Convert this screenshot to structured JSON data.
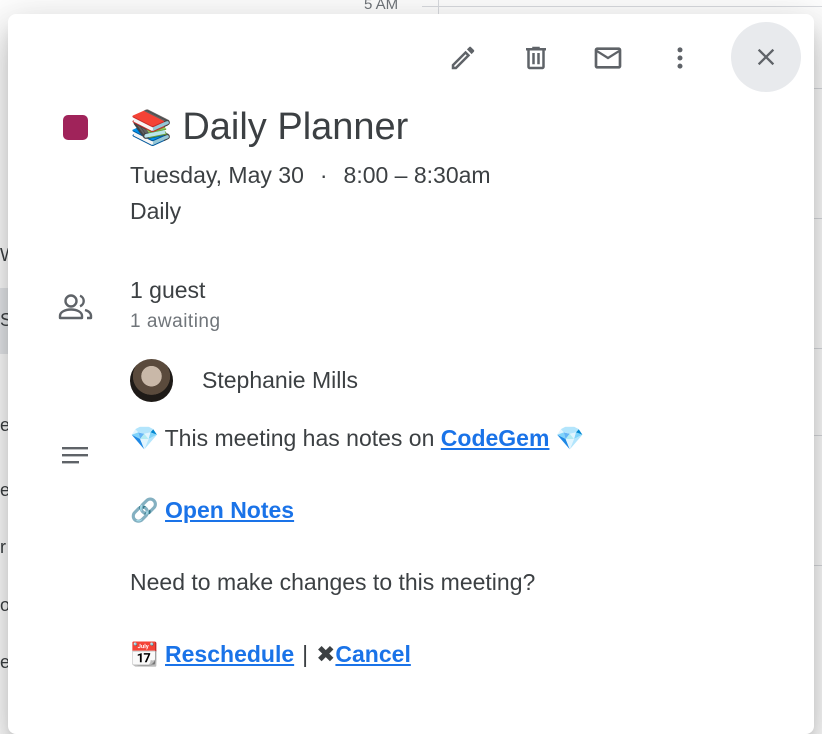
{
  "background": {
    "time_label": "5 AM",
    "fragments": [
      "W",
      "S",
      "e",
      "e",
      "r",
      "o",
      "e"
    ]
  },
  "toolbar": {
    "edit_icon": "pencil-icon",
    "delete_icon": "trash-icon",
    "email_icon": "envelope-icon",
    "more_icon": "more-vert-icon",
    "close_icon": "close-icon"
  },
  "event": {
    "color": "#a0235a",
    "title_emoji": "📚",
    "title": "Daily Planner",
    "date": "Tuesday, May 30",
    "separator": "·",
    "time": "8:00 – 8:30am",
    "recurrence": "Daily"
  },
  "guests": {
    "count": "1 guest",
    "status": "1 awaiting",
    "list": [
      {
        "name": "Stephanie Mills"
      }
    ]
  },
  "description": {
    "line1_prefix_emoji": "💎",
    "line1_text": "This meeting has notes on ",
    "line1_link": "CodeGem",
    "line1_suffix_emoji": "💎",
    "line2_emoji": "🔗",
    "line2_link": "Open Notes",
    "line3_text": "Need to make changes to this meeting?",
    "line4_emoji": "📆",
    "reschedule_link": "Reschedule",
    "divider": "|",
    "cancel_emoji": "✖",
    "cancel_link": "Cancel"
  },
  "colors": {
    "link": "#1a73e8",
    "text": "#3c4043",
    "muted": "#70757a"
  }
}
